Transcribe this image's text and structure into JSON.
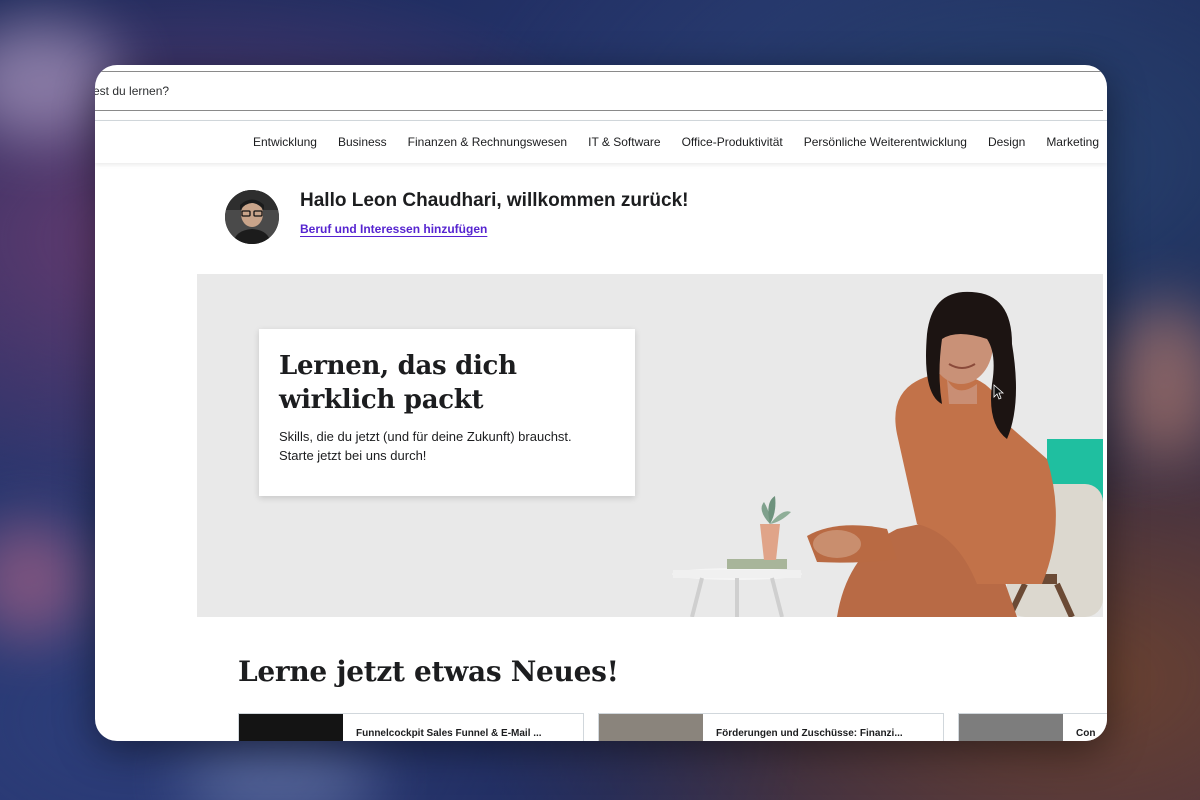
{
  "search": {
    "placeholder": "est du lernen?"
  },
  "nav": {
    "categories": [
      "Entwicklung",
      "Business",
      "Finanzen & Rechnungswesen",
      "IT & Software",
      "Office-Produktivität",
      "Persönliche Weiterentwicklung",
      "Design",
      "Marketing"
    ]
  },
  "greeting": {
    "title": "Hallo Leon Chaudhari, willkommen zurück!",
    "link": "Beruf und Interessen hinzufügen"
  },
  "hero": {
    "title_line1": "Lernen, das dich",
    "title_line2": "wirklich packt",
    "subtitle_line1": "Skills, die du jetzt (und für deine Zukunft) brauchst.",
    "subtitle_line2": "Starte jetzt bei uns durch!"
  },
  "section": {
    "title": "Lerne jetzt etwas Neues!"
  },
  "courses": [
    {
      "title": "Funnelcockpit Sales Funnel & E-Mail ..."
    },
    {
      "title": "Förderungen und Zuschüsse: Finanzi..."
    },
    {
      "title": "Con"
    }
  ],
  "colors": {
    "link": "#5624d0",
    "text": "#1c1d1f",
    "hero_bg": "#e9e9e9",
    "accent_teal": "#1fbfa0"
  },
  "icons": {
    "cursor": "mouse-pointer-icon"
  }
}
